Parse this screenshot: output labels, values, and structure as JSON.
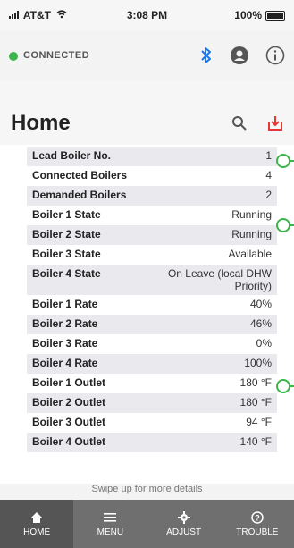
{
  "status_bar": {
    "carrier": "AT&T",
    "time": "3:08 PM",
    "battery": "100%"
  },
  "connection": {
    "label": "CONNECTED",
    "color": "#3bb54a"
  },
  "header": {
    "title": "Home"
  },
  "rows": [
    {
      "label": "Lead Boiler No.",
      "value": "1"
    },
    {
      "label": "Connected Boilers",
      "value": "4"
    },
    {
      "label": "Demanded Boilers",
      "value": "2"
    },
    {
      "label": "Boiler 1 State",
      "value": "Running"
    },
    {
      "label": "Boiler 2 State",
      "value": "Running"
    },
    {
      "label": "Boiler 3 State",
      "value": "Available"
    },
    {
      "label": "Boiler 4 State",
      "value": "On Leave (local DHW Priority)"
    },
    {
      "label": "Boiler 1 Rate",
      "value": "40%"
    },
    {
      "label": "Boiler 2 Rate",
      "value": "46%"
    },
    {
      "label": "Boiler 3 Rate",
      "value": "0%"
    },
    {
      "label": "Boiler 4 Rate",
      "value": "100%"
    },
    {
      "label": "Boiler 1 Outlet",
      "value": "180 °F"
    },
    {
      "label": "Boiler 2 Outlet",
      "value": "180 °F"
    },
    {
      "label": "Boiler 3 Outlet",
      "value": "94 °F"
    },
    {
      "label": "Boiler 4 Outlet",
      "value": "140 °F"
    }
  ],
  "footer": {
    "hint": "Swipe up for more details"
  },
  "nav": [
    {
      "label": "HOME",
      "icon": "home-icon"
    },
    {
      "label": "MENU",
      "icon": "menu-icon"
    },
    {
      "label": "ADJUST",
      "icon": "gear-icon"
    },
    {
      "label": "TROUBLE",
      "icon": "help-icon"
    }
  ],
  "colors": {
    "accent_green": "#3bb54a",
    "bluetooth_blue": "#1a73e8",
    "download_red": "#e53935",
    "nav_bg": "#6f6f6f",
    "nav_active": "#555555"
  }
}
